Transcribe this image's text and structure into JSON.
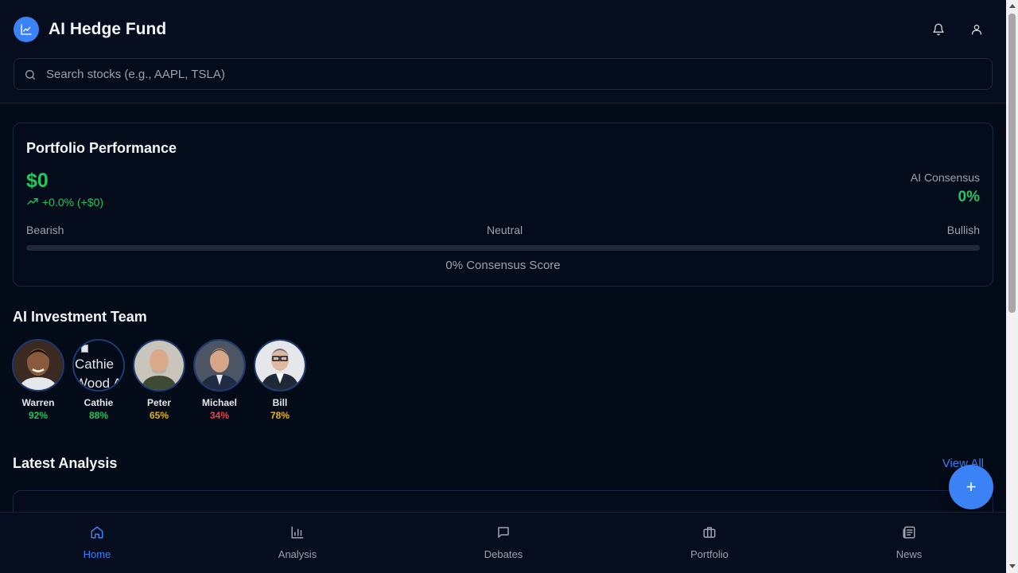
{
  "app": {
    "title": "AI Hedge Fund",
    "logo_icon": "chart-line-icon"
  },
  "header": {
    "notification_icon": "bell-icon",
    "profile_icon": "user-icon"
  },
  "search": {
    "placeholder": "Search stocks (e.g., AAPL, TSLA)",
    "value": ""
  },
  "portfolio": {
    "title": "Portfolio Performance",
    "value": "$0",
    "change": "+0.0% (+$0)",
    "consensus_label": "AI Consensus",
    "consensus_value": "0%",
    "scale": {
      "left": "Bearish",
      "middle": "Neutral",
      "right": "Bullish"
    },
    "consensus_fill": 0,
    "score_text": "0% Consensus Score"
  },
  "team": {
    "title": "AI Investment Team",
    "members": [
      {
        "name": "Warren",
        "score": "92%",
        "color": "#22c55e"
      },
      {
        "name": "Cathie",
        "score": "88%",
        "color": "#22c55e",
        "image_alt": "Cathie Wood A"
      },
      {
        "name": "Peter",
        "score": "65%",
        "color": "#eab308"
      },
      {
        "name": "Michael",
        "score": "34%",
        "color": "#ef4444"
      },
      {
        "name": "Bill",
        "score": "78%",
        "color": "#eab308"
      }
    ]
  },
  "analysis": {
    "title": "Latest Analysis",
    "view_all": "View All"
  },
  "fab": {
    "label": "+"
  },
  "nav": {
    "items": [
      {
        "label": "Home",
        "icon": "home-icon",
        "active": true
      },
      {
        "label": "Analysis",
        "icon": "bar-chart-icon",
        "active": false
      },
      {
        "label": "Debates",
        "icon": "message-icon",
        "active": false
      },
      {
        "label": "Portfolio",
        "icon": "briefcase-icon",
        "active": false
      },
      {
        "label": "News",
        "icon": "newspaper-icon",
        "active": false
      }
    ]
  },
  "colors": {
    "accent": "#3b82f6",
    "positive": "#22c55e",
    "warning": "#eab308",
    "negative": "#ef4444",
    "background": "#030a18"
  }
}
